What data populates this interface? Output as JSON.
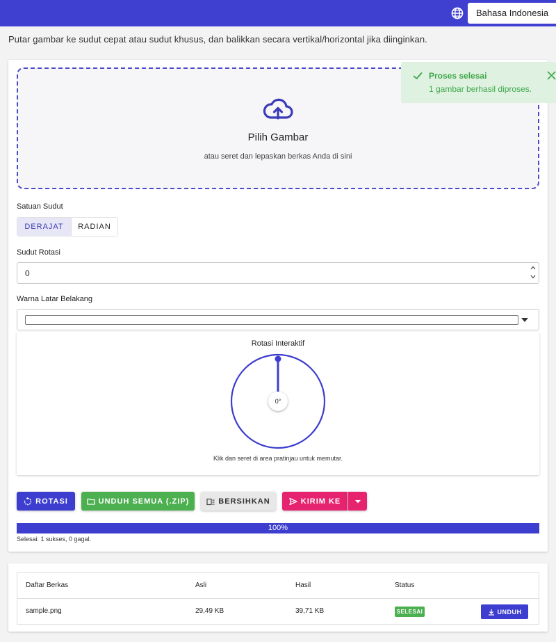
{
  "header": {
    "language": "Bahasa Indonesia",
    "globe_icon": "globe-icon",
    "bar_color": "#4040d0"
  },
  "intro": "Putar gambar ke sudut cepat atau sudut khusus, dan balikkan secara vertikal/horizontal jika diinginkan.",
  "dropzone": {
    "icon": "cloud-upload-icon",
    "title": "Pilih Gambar",
    "subtitle": "atau seret dan lepaskan berkas Anda di sini"
  },
  "toast": {
    "title": "Proses selesai",
    "message": "1 gambar berhasil diproses.",
    "color": "#3fa64a"
  },
  "angle_unit": {
    "label": "Satuan Sudut",
    "options": [
      "DERAJAT",
      "RADIAN"
    ],
    "selected": "DERAJAT"
  },
  "rotation_angle": {
    "label": "Sudut Rotasi",
    "value": "0"
  },
  "background_color": {
    "label": "Warna Latar Belakang",
    "value": "#ffffff"
  },
  "interactive_rotation": {
    "title": "Rotasi Interaktif",
    "angle_readout": "0°",
    "angle_degrees": 0,
    "hint": "Klik dan seret di area pratinjau untuk memutar."
  },
  "actions": {
    "rotate": "ROTASI",
    "download_all": "UNDUH SEMUA (.ZIP)",
    "clear": "BERSIHKAN",
    "send_to": "KIRIM KE"
  },
  "progress": {
    "percent": 100,
    "label": "100%",
    "summary": "Selesai: 1 sukses, 0 gagal."
  },
  "files": {
    "columns": [
      "Daftar Berkas",
      "Asli",
      "Hasil",
      "Status"
    ],
    "rows": [
      {
        "name": "sample.png",
        "original": "29,49 KB",
        "result": "39,71 KB",
        "status": "SELESAI",
        "action": "UNDUH"
      }
    ]
  },
  "colors": {
    "primary": "#3d3dcf",
    "success": "#4caf50",
    "send": "#e5236f"
  }
}
